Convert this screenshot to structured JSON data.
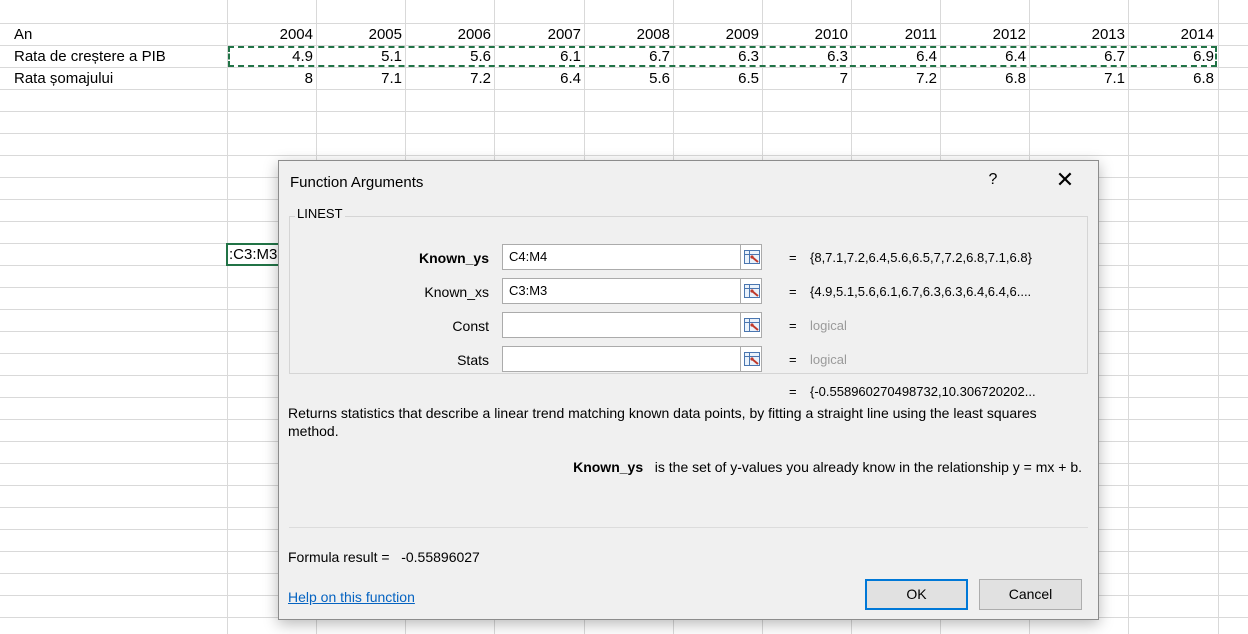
{
  "sheet": {
    "rows": [
      {
        "label": "An",
        "values": [
          "2004",
          "2005",
          "2006",
          "2007",
          "2008",
          "2009",
          "2010",
          "2011",
          "2012",
          "2013",
          "2014"
        ]
      },
      {
        "label": "Rata de creștere a PIB",
        "values": [
          "4.9",
          "5.1",
          "5.6",
          "6.1",
          "6.7",
          "6.3",
          "6.3",
          "6.4",
          "6.4",
          "6.7",
          "6.9"
        ]
      },
      {
        "label": "Rata șomajului",
        "values": [
          "8",
          "7.1",
          "7.2",
          "6.4",
          "5.6",
          "6.5",
          "7",
          "7.2",
          "6.8",
          "7.1",
          "6.8"
        ]
      }
    ],
    "active_cell_text": ":C3:M3",
    "marquee_color": "#217346"
  },
  "dialog": {
    "title": "Function Arguments",
    "help_glyph": "?",
    "close_glyph": "✕",
    "function_name": "LINEST",
    "args": [
      {
        "label": "Known_ys",
        "value": "C4:M4",
        "result": "{8,7.1,7.2,6.4,5.6,6.5,7,7.2,6.8,7.1,6.8}"
      },
      {
        "label": "Known_xs",
        "value": "C3:M3",
        "result": "{4.9,5.1,5.6,6.1,6.7,6.3,6.3,6.4,6.4,6...."
      },
      {
        "label": "Const",
        "value": "",
        "result": "logical"
      },
      {
        "label": "Stats",
        "value": "",
        "result": "logical"
      }
    ],
    "equals": "=",
    "function_result": "{-0.558960270498732,10.306720202...",
    "description": "Returns statistics that describe a linear trend matching known data points, by fitting a straight line using the least squares method.",
    "arg_help_name": "Known_ys",
    "arg_help_text": "is the set of y-values you already know in the relationship y = mx + b.",
    "formula_result_label": "Formula result =",
    "formula_result_value": "-0.55896027",
    "help_link": "Help on this function",
    "ok_label": "OK",
    "cancel_label": "Cancel",
    "ref_icon": "range-select-icon"
  }
}
